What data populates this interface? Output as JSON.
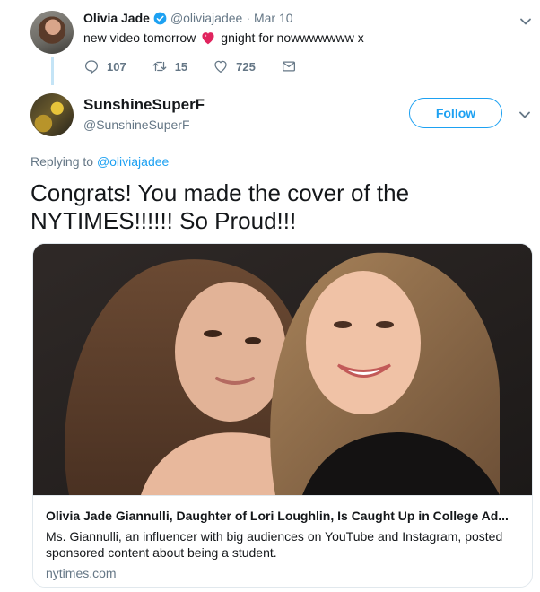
{
  "parent_tweet": {
    "author_name": "Olivia Jade",
    "author_handle": "@oliviajadee",
    "separator": "·",
    "date": "Mar 10",
    "text_before": "new video tomorrow",
    "text_after": "gnight for nowwwwwww x",
    "actions": {
      "replies": "107",
      "retweets": "15",
      "likes": "725"
    }
  },
  "main_tweet": {
    "author_name": "SunshineSuperF",
    "author_handle": "@SunshineSuperF",
    "follow_label": "Follow",
    "replying_prefix": "Replying to",
    "replying_to": "@oliviajadee",
    "text": "Congrats!  You made the cover of the NYTIMES!!!!!!  So Proud!!!",
    "card": {
      "title": "Olivia Jade Giannulli, Daughter of Lori Loughlin, Is Caught Up in College Ad...",
      "description": "Ms. Giannulli, an influencer with big audiences on YouTube and Instagram, posted sponsored content about being a student.",
      "domain": "nytimes.com"
    }
  },
  "colors": {
    "link_blue": "#1da1f2",
    "secondary_text": "#657786",
    "heart_red": "#e0245e"
  },
  "icons": [
    "verified-badge-icon",
    "heart-emoji-icon",
    "reply-icon",
    "retweet-icon",
    "like-icon",
    "direct-message-icon",
    "chevron-down-icon"
  ]
}
